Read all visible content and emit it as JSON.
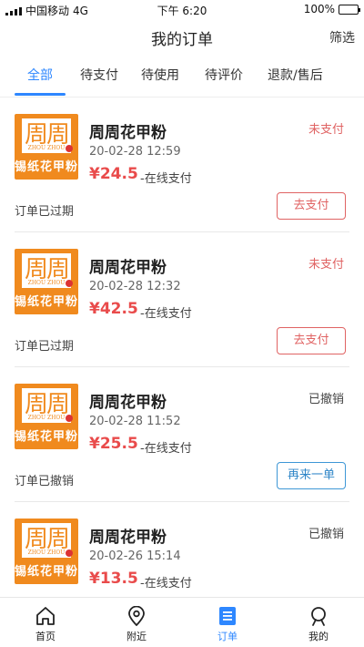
{
  "status_bar": {
    "carrier": "中国移动",
    "network": "4G",
    "time": "下午 6:20",
    "battery": "100%"
  },
  "nav": {
    "title": "我的订单",
    "filter_label": "筛选"
  },
  "tabs": [
    {
      "label": "全部",
      "active": true
    },
    {
      "label": "待支付",
      "active": false
    },
    {
      "label": "待使用",
      "active": false
    },
    {
      "label": "待评价",
      "active": false
    },
    {
      "label": "退款/售后",
      "active": false
    }
  ],
  "logo": {
    "stamp_text": "周周",
    "stamp_subtext": "ZHOU ZHOU",
    "brand_text": "锡纸花甲粉"
  },
  "orders": [
    {
      "shop": "周周花甲粉",
      "time": "20-02-28 12:59",
      "price": "¥24.5",
      "payment": "-在线支付",
      "status": "未支付",
      "note": "订单已过期",
      "action": "去支付"
    },
    {
      "shop": "周周花甲粉",
      "time": "20-02-28 12:32",
      "price": "¥42.5",
      "payment": "-在线支付",
      "status": "未支付",
      "note": "订单已过期",
      "action": "去支付"
    },
    {
      "shop": "周周花甲粉",
      "time": "20-02-28 11:52",
      "price": "¥25.5",
      "payment": "-在线支付",
      "status": "已撤销",
      "note": "订单已撤销",
      "action": "再来一单"
    },
    {
      "shop": "周周花甲粉",
      "time": "20-02-26 15:14",
      "price": "¥13.5",
      "payment": "-在线支付",
      "status": "已撤销"
    }
  ],
  "tabbar": [
    {
      "label": "首页",
      "icon": "home-icon"
    },
    {
      "label": "附近",
      "icon": "location-pin-icon"
    },
    {
      "label": "订单",
      "icon": "order-list-icon",
      "active": true
    },
    {
      "label": "我的",
      "icon": "profile-icon"
    }
  ],
  "colors": {
    "accent": "#2e87ff",
    "price_red": "#e94b4b",
    "brand_orange": "#f08a1e",
    "reorder_blue": "#2f86c8"
  }
}
